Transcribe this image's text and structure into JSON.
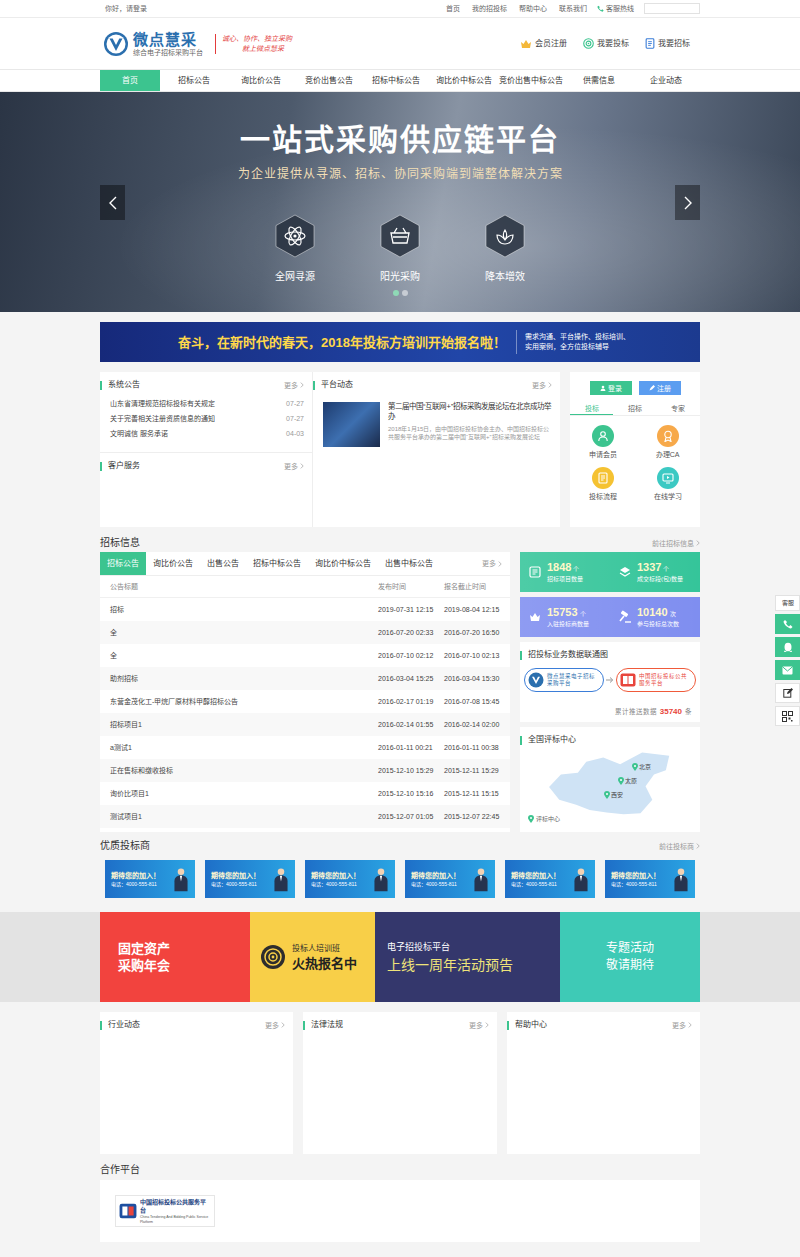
{
  "topbar": {
    "greeting": "你好，请登录",
    "links": [
      "首页",
      "我的招投标",
      "帮助中心",
      "联系我们"
    ],
    "hotline": "客服热线"
  },
  "header": {
    "brand": "微点慧采",
    "tagline": "综合电子招标采购平台",
    "slogan": [
      "诚心、协作、独立采购",
      "就上微点慧采"
    ],
    "actions": [
      "会员注册",
      "我要投标",
      "我要招标"
    ]
  },
  "nav": [
    {
      "label": "首页",
      "selected": true
    },
    {
      "label": "招标公告",
      "selected": false
    },
    {
      "label": "询比价公告",
      "selected": false
    },
    {
      "label": "竞价出售公告",
      "selected": false
    },
    {
      "label": "招标中标公告",
      "selected": false
    },
    {
      "label": "询比价中标公告",
      "selected": false
    },
    {
      "label": "竞价出售中标公告",
      "selected": false
    },
    {
      "label": "供需信息",
      "selected": false
    },
    {
      "label": "企业动态",
      "selected": false
    }
  ],
  "banner": {
    "title": "一站式采购供应链平台",
    "subtitle": "为企业提供从寻源、招标、协同采购端到端整体解决方案",
    "features": [
      "全网寻源",
      "阳光采购",
      "降本增效"
    ],
    "slides": [
      {
        "selected": true
      },
      {
        "selected": false
      }
    ]
  },
  "training_banner": {
    "headline": "奋斗，在新时代的春天，2018年投标方培训开始报名啦！",
    "detail": "需求沟通、平台操作、投标培训、实用案例，全方位投标辅导"
  },
  "system_notice": {
    "title": "系统公告",
    "more": "更多",
    "items": [
      {
        "title": "山东省清理规范招标投标有关规定",
        "date": "07-27"
      },
      {
        "title": "关于完善相关注册资质信息的通知",
        "date": "07-27"
      },
      {
        "title": "文明诚信 服务承诺",
        "date": "04-03"
      }
    ]
  },
  "customer_service": {
    "title": "客户服务",
    "more": "更多"
  },
  "platform_news": {
    "title": "平台动态",
    "more": "更多",
    "article": {
      "title": "第二届中国“互联网+”招标采购发展论坛在北京成功举办",
      "summary": "2018年1月15日，由中国招标投标协会主办、中国招标投标公共服务平台承办的第二届中国“互联网+”招标采购发展论坛"
    }
  },
  "account": {
    "login": "登录",
    "register": "注册",
    "tabs": [
      {
        "label": "投标",
        "selected": true
      },
      {
        "label": "招标",
        "selected": false
      },
      {
        "label": "专家",
        "selected": false
      }
    ],
    "shortcuts": [
      {
        "label": "申请会员",
        "color": "#3cc48f"
      },
      {
        "label": "办理CA",
        "color": "#f7a94a"
      },
      {
        "label": "投标流程",
        "color": "#f5c232"
      },
      {
        "label": "在线学习",
        "color": "#3cc9c3"
      }
    ]
  },
  "tender_info": {
    "title": "招标信息",
    "link": "前往招标信息",
    "tabs": [
      {
        "label": "招标公告",
        "selected": true
      },
      {
        "label": "询比价公告",
        "selected": false
      },
      {
        "label": "出售公告",
        "selected": false
      },
      {
        "label": "招标中标公告",
        "selected": false
      },
      {
        "label": "询比价中标公告",
        "selected": false
      },
      {
        "label": "出售中标公告",
        "selected": false
      }
    ],
    "more": "更多",
    "columns": [
      "公告标题",
      "发布时间",
      "报名截止时间"
    ],
    "rows": [
      [
        "招标",
        "2019-07-31 12:15",
        "2019-08-04 12:15"
      ],
      [
        "全",
        "2016-07-20 02:33",
        "2016-07-20 16:50"
      ],
      [
        "全",
        "2016-07-10 02:12",
        "2016-07-10 02:13"
      ],
      [
        "助剂招标",
        "2016-03-04 15:25",
        "2016-03-04 15:30"
      ],
      [
        "东营金茂化工-甲烷厂原材料甲醇招标公告",
        "2016-02-17 01:19",
        "2016-07-08 15:45"
      ],
      [
        "招标项目1",
        "2016-02-14 01:55",
        "2016-02-14 02:00"
      ],
      [
        "a测试1",
        "2016-01-11 00:21",
        "2016-01-11 00:38"
      ],
      [
        "正在售标和缴收投标",
        "2015-12-10 15:29",
        "2015-12-11 15:29"
      ],
      [
        "询价比项目1",
        "2015-12-10 15:16",
        "2015-12-11 15:15"
      ],
      [
        "测试项目1",
        "2015-12-07 01:05",
        "2015-12-07 22:45"
      ]
    ]
  },
  "stats": {
    "cards": [
      {
        "color": "#35c59a",
        "items": [
          {
            "value": "1848",
            "unit": "个",
            "label": "招标项目数量"
          },
          {
            "value": "1337",
            "unit": "个",
            "label": "成交标段(包)数量"
          }
        ]
      },
      {
        "color": "#7f8ef0",
        "items": [
          {
            "value": "15753",
            "unit": "个",
            "label": "入驻投标商数量"
          },
          {
            "value": "10140",
            "unit": "次",
            "label": "参与投标总次数"
          }
        ]
      }
    ]
  },
  "data_link": {
    "title": "招投标业务数据联通图",
    "nodes": [
      "微点慧采电子招标采购平台",
      "中国招标投标公共服务平台"
    ],
    "total_label": "累计推送数据",
    "total": "35740",
    "total_unit": "条"
  },
  "eval_map": {
    "title": "全国评标中心",
    "cities": [
      "北京",
      "太原",
      "西安"
    ],
    "legend": "评标中心"
  },
  "bidders": {
    "title": "优质投标商",
    "link": "前往投标商",
    "cards": [
      {
        "headline": "期待您的加入！",
        "phone": "电话：4000-555-811"
      },
      {
        "headline": "期待您的加入！",
        "phone": "电话：4000-555-811"
      },
      {
        "headline": "期待您的加入！",
        "phone": "电话：4000-555-811"
      },
      {
        "headline": "期待您的加入！",
        "phone": "电话：4000-555-811"
      },
      {
        "headline": "期待您的加入！",
        "phone": "电话：4000-555-811"
      },
      {
        "headline": "期待您的加入！",
        "phone": "电话：4000-555-811"
      }
    ]
  },
  "promos": [
    {
      "kind": "stacked",
      "color": "#f2433e",
      "lines": [
        "固定资产",
        "采购年会"
      ]
    },
    {
      "kind": "badge",
      "color": "#f8cf48",
      "badge": "投标人培训班",
      "headline": "火热报名中"
    },
    {
      "kind": "heading",
      "color": "#34376c",
      "title": "电子招投标平台",
      "headline": "上线一周年活动预告"
    },
    {
      "kind": "stacked",
      "color": "#3ecab6",
      "lines": [
        "专题活动",
        "敬请期待"
      ]
    }
  ],
  "info_boxes": [
    {
      "title": "行业动态",
      "more": "更多"
    },
    {
      "title": "法律法规",
      "more": "更多"
    },
    {
      "title": "帮助中心",
      "more": "更多"
    }
  ],
  "partners": {
    "title": "合作平台",
    "items": [
      {
        "name": "中国招标投标公共服务平台",
        "subtitle": "China Tendering And Bidding Public Service Platform"
      }
    ]
  },
  "float_bar": {
    "label": "客服"
  }
}
